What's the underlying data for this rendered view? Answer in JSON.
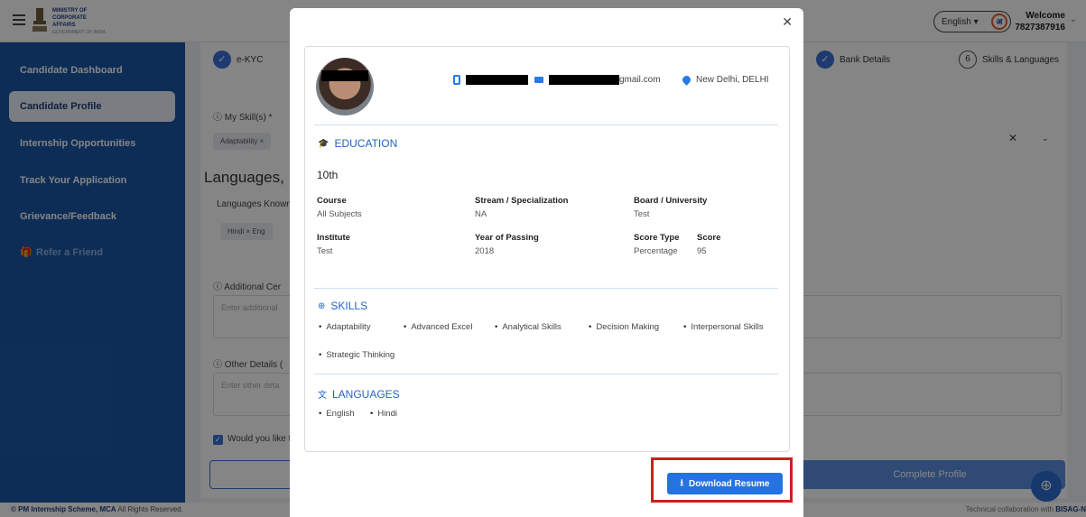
{
  "header": {
    "logo_lines": [
      "MINISTRY OF",
      "CORPORATE",
      "AFFAIRS",
      "GOVERNMENT OF INDIA"
    ],
    "language": "English",
    "language_icon": "अ",
    "welcome_label": "Welcome",
    "phone": "7827387916"
  },
  "sidebar": {
    "items": [
      {
        "label": "Candidate Dashboard"
      },
      {
        "label": "Candidate Profile"
      },
      {
        "label": "Internship Opportunities"
      },
      {
        "label": "Track Your Application"
      },
      {
        "label": "Grievance/Feedback"
      },
      {
        "label": "Refer a Friend"
      }
    ]
  },
  "steps": {
    "ekyc": "e-KYC",
    "bank": "Bank Details",
    "skills_num": "6",
    "skills": "Skills & Languages"
  },
  "form": {
    "my_skills_label": "My Skill(s) *",
    "skill_chip": "Adaptability ×",
    "languages_heading": "Languages,",
    "languages_known": "Languages Known",
    "lang_chip": "Hindi ×  Eng",
    "additional_label": "Additional Cer",
    "additional_placeholder": "Enter additional",
    "other_label": "Other Details (",
    "other_placeholder": "Enter other deta",
    "consent": "Would you like t",
    "complete_button": "Complete Profile"
  },
  "modal": {
    "email_suffix": "gmail.com",
    "location": "New Delhi, DELHI",
    "education_title": "EDUCATION",
    "education_level": "10th",
    "fields": {
      "course_label": "Course",
      "course_value": "All Subjects",
      "stream_label": "Stream / Specialization",
      "stream_value": "NA",
      "board_label": "Board / University",
      "board_value": "Test",
      "institute_label": "Institute",
      "institute_value": "Test",
      "year_label": "Year of Passing",
      "year_value": "2018",
      "score_type_label": "Score Type",
      "score_type_value": "Percentage",
      "score_label": "Score",
      "score_value": "95"
    },
    "skills_title": "SKILLS",
    "skills": [
      "Adaptability",
      "Advanced Excel",
      "Analytical Skills",
      "Decision Making",
      "Interpersonal Skills",
      "Strategic Thinking"
    ],
    "languages_title": "LANGUAGES",
    "languages": [
      "English",
      "Hindi"
    ],
    "download_label": "Download Resume"
  },
  "footer": {
    "left_bold": "© PM Internship Scheme, MCA",
    "left_rest": " All Rights Reserved.",
    "right_text": "Technical collaboration with ",
    "right_bold": "BISAG-N"
  }
}
